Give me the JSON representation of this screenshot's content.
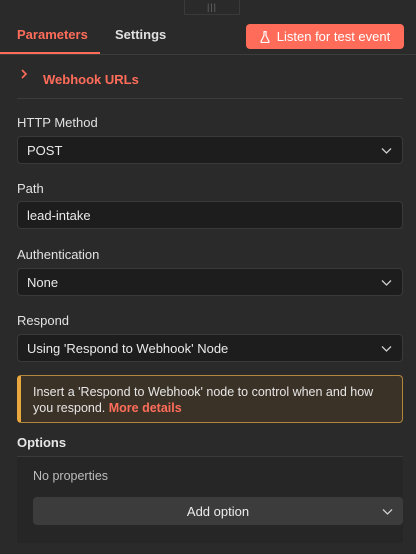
{
  "drag_handle": {
    "glyph": "|||"
  },
  "tabs": [
    {
      "label": "Parameters",
      "active": true
    },
    {
      "label": "Settings",
      "active": false
    }
  ],
  "listen_button": {
    "label": "Listen for test event",
    "icon": "flask-icon",
    "color": "#ff6d5a"
  },
  "webhook_urls": {
    "label": "Webhook URLs",
    "icon": "chevron-right-icon"
  },
  "fields": {
    "http_method": {
      "label": "HTTP Method",
      "value": "POST"
    },
    "path": {
      "label": "Path",
      "value": "lead-intake"
    },
    "authentication": {
      "label": "Authentication",
      "value": "None"
    },
    "respond": {
      "label": "Respond",
      "value": "Using 'Respond to Webhook' Node"
    }
  },
  "callout": {
    "text": "Insert a 'Respond to Webhook' node to control when and how you respond.",
    "link": "More details",
    "border_color": "#e8a83e"
  },
  "options": {
    "label": "Options",
    "empty_text": "No properties",
    "add_button": "Add option"
  }
}
